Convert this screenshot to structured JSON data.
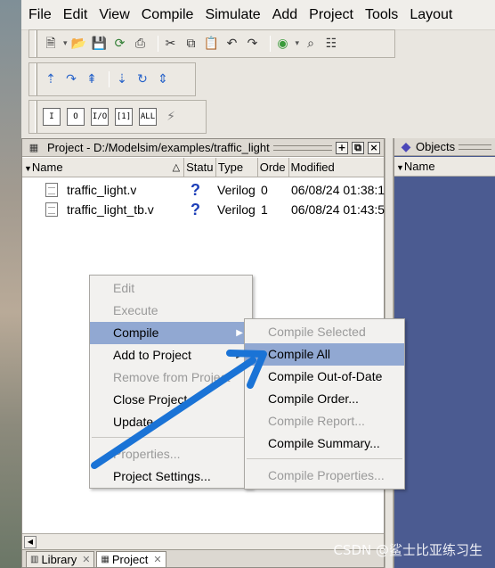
{
  "menubar": [
    "File",
    "Edit",
    "View",
    "Compile",
    "Simulate",
    "Add",
    "Project",
    "Tools",
    "Layout"
  ],
  "toolbar3": {
    "labels": [
      "I",
      "O",
      "I/O",
      "[1]",
      "ALL"
    ]
  },
  "project_panel": {
    "title": "Project - D:/Modelsim/examples/traffic_light",
    "columns": [
      "Name",
      "Status",
      "Type",
      "Order",
      "Modified"
    ],
    "column_display": [
      "Name",
      "Statu",
      "Type",
      "Orde",
      "Modified"
    ],
    "files": [
      {
        "name": "traffic_light.v",
        "status": "?",
        "type": "Verilog",
        "order": "0",
        "modified": "06/08/24 01:38:1"
      },
      {
        "name": "traffic_light_tb.v",
        "status": "?",
        "type": "Verilog",
        "order": "1",
        "modified": "06/08/24 01:43:5"
      }
    ],
    "tabs": [
      {
        "label": "Library",
        "active": false
      },
      {
        "label": "Project",
        "active": true
      }
    ]
  },
  "objects_panel": {
    "title": "Objects",
    "column": "Name"
  },
  "context_menu": {
    "items": [
      {
        "label": "Edit",
        "enabled": false
      },
      {
        "label": "Execute",
        "enabled": false
      },
      {
        "label": "Compile",
        "enabled": true,
        "highlighted": true,
        "has_submenu": true
      },
      {
        "label": "Add to Project",
        "enabled": true,
        "has_submenu": true
      },
      {
        "label": "Remove from Project",
        "enabled": false
      },
      {
        "label": "Close Project",
        "enabled": true
      },
      {
        "label": "Update",
        "enabled": true
      },
      {
        "label": "Properties...",
        "enabled": false
      },
      {
        "label": "Project Settings...",
        "enabled": true
      }
    ]
  },
  "compile_submenu": {
    "items": [
      {
        "label": "Compile Selected",
        "enabled": false
      },
      {
        "label": "Compile All",
        "enabled": true,
        "highlighted": true
      },
      {
        "label": "Compile Out-of-Date",
        "enabled": true
      },
      {
        "label": "Compile Order...",
        "enabled": true
      },
      {
        "label": "Compile Report...",
        "enabled": false
      },
      {
        "label": "Compile Summary...",
        "enabled": true
      },
      {
        "label": "Compile Properties...",
        "enabled": false
      }
    ]
  },
  "colors": {
    "highlight": "#91a8d2",
    "objects_bg": "#4b5b91",
    "annotation_arrow": "#1a73d6"
  },
  "watermark": "CSDN @鲨士比亚练习生"
}
